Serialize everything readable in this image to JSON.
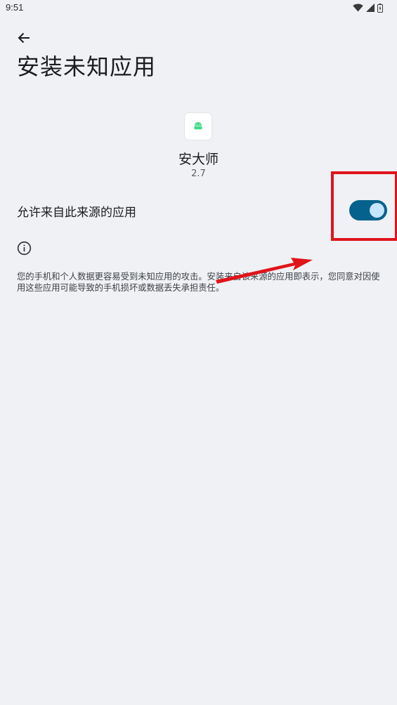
{
  "status_bar": {
    "time": "9:51",
    "icons": [
      "wifi-icon",
      "signal-icon",
      "battery-icon"
    ]
  },
  "header": {
    "back_icon": "arrow-back-icon",
    "title": "安装未知应用"
  },
  "app": {
    "name": "安大师",
    "version": "2.7",
    "icon": "android-icon",
    "icon_color": "#3ddc84"
  },
  "setting": {
    "label": "允许来自此来源的应用",
    "enabled": true,
    "track_color": "#04628d",
    "thumb_color": "#c6e6ff"
  },
  "info": {
    "icon": "info-icon",
    "text": "您的手机和个人数据更容易受到未知应用的攻击。安装来自该来源的应用即表示，您同意对因使用这些应用可能导致的手机损坏或数据丢失承担责任。"
  },
  "annotation": {
    "highlight_color": "#e0141b",
    "arrow_color": "#e0141b"
  }
}
